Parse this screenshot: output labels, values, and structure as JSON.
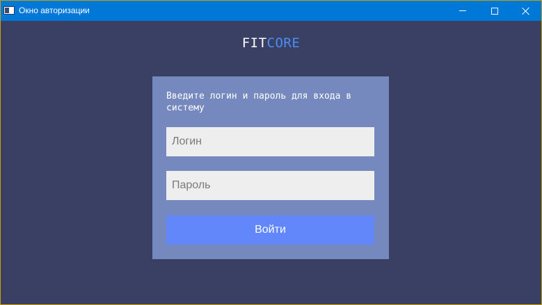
{
  "window": {
    "title": "Окно авторизации",
    "controls": {
      "minimize": "minimize",
      "maximize": "maximize",
      "close": "close"
    }
  },
  "brand": {
    "part1": "FIT",
    "part2": "CORE",
    "part1_color": "#ffffff",
    "part2_color": "#4d8df5"
  },
  "login_form": {
    "prompt": "Введите логин и пароль для входа в систему",
    "login": {
      "value": "",
      "placeholder": "Логин"
    },
    "password": {
      "value": "",
      "placeholder": "Пароль"
    },
    "submit_label": "Войти"
  },
  "colors": {
    "titlebar": "#0078d7",
    "background": "#3a4064",
    "card": "#7689be",
    "field": "#eeeeee",
    "button": "#6287fa"
  },
  "icons": [
    "app-window-icon",
    "minimize-icon",
    "maximize-icon",
    "close-icon"
  ]
}
